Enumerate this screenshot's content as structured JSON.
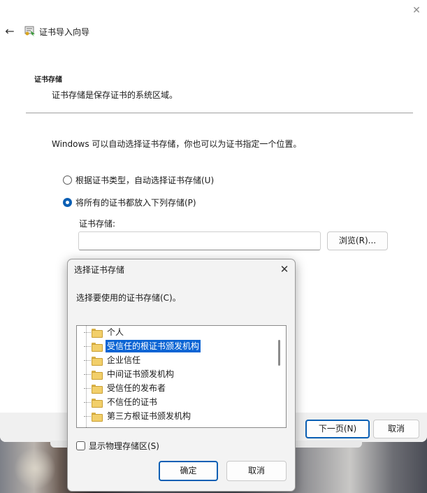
{
  "wizard": {
    "title": "证书导入向导",
    "close_glyph": "✕",
    "back_glyph": "←",
    "section_title": "证书存储",
    "section_desc": "证书存储是保存证书的系统区域。",
    "intro": "Windows 可以自动选择证书存储，你也可以为证书指定一个位置。",
    "radio_auto": "根据证书类型，自动选择证书存储(U)",
    "radio_manual": "将所有的证书都放入下列存储(P)",
    "store_label": "证书存储:",
    "store_value": "",
    "browse_label": "浏览(R)...",
    "next_label": "下一页(N)",
    "cancel_label": "取消",
    "selected_radio": "manual"
  },
  "dialog": {
    "title": "选择证书存储",
    "close_glyph": "✕",
    "prompt": "选择要使用的证书存储(C)。",
    "stores": [
      "个人",
      "受信任的根证书颁发机构",
      "企业信任",
      "中间证书颁发机构",
      "受信任的发布者",
      "不信任的证书",
      "第三方根证书颁发机构"
    ],
    "selected_index": 1,
    "show_physical_label": "显示物理存储区(S)",
    "show_physical_checked": false,
    "ok_label": "确定",
    "cancel_label": "取消"
  },
  "colors": {
    "accent": "#0a5fb4",
    "selection": "#0a64d4",
    "folder": "#f2cf6a"
  }
}
